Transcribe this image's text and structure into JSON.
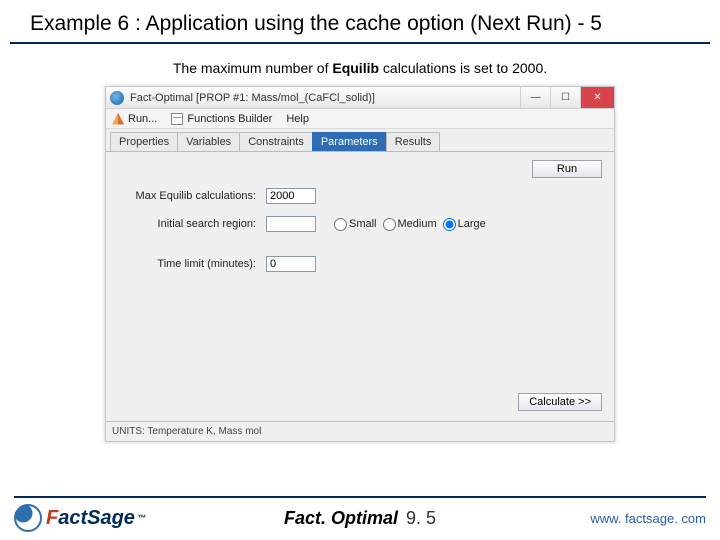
{
  "slide": {
    "title": "Example 6 : Application using the cache option (Next Run) - 5",
    "caption_pre": "The maximum number of ",
    "caption_bold": "Equilib",
    "caption_post": " calculations is set to 2000."
  },
  "window": {
    "title": "Fact-Optimal   [PROP #1: Mass/mol_(CaFCl_solid)]",
    "min_glyph": "—",
    "max_glyph": "☐",
    "close_glyph": "✕"
  },
  "menu": {
    "run": "Run...",
    "functions": "Functions Builder",
    "help": "Help"
  },
  "tabs": {
    "properties": "Properties",
    "variables": "Variables",
    "constraints": "Constraints",
    "parameters": "Parameters",
    "results": "Results"
  },
  "form": {
    "max_equilib_label": "Max Equilib calculations:",
    "max_equilib_value": "2000",
    "init_region_label": "Initial search region:",
    "init_region_value": "",
    "radio_small": "Small",
    "radio_medium": "Medium",
    "radio_large": "Large",
    "time_label": "Time limit (minutes):",
    "time_value": "0",
    "run_btn": "Run"
  },
  "status": {
    "units": "UNITS: Temperature K, Mass mol",
    "calc_btn": "Calculate >>"
  },
  "footer": {
    "logo_f": "F",
    "logo_act": "act",
    "logo_sage": "Sage",
    "logo_tm": "™",
    "center_name": "Fact. Optimal",
    "center_ver": "9. 5",
    "url": "www. factsage. com"
  }
}
